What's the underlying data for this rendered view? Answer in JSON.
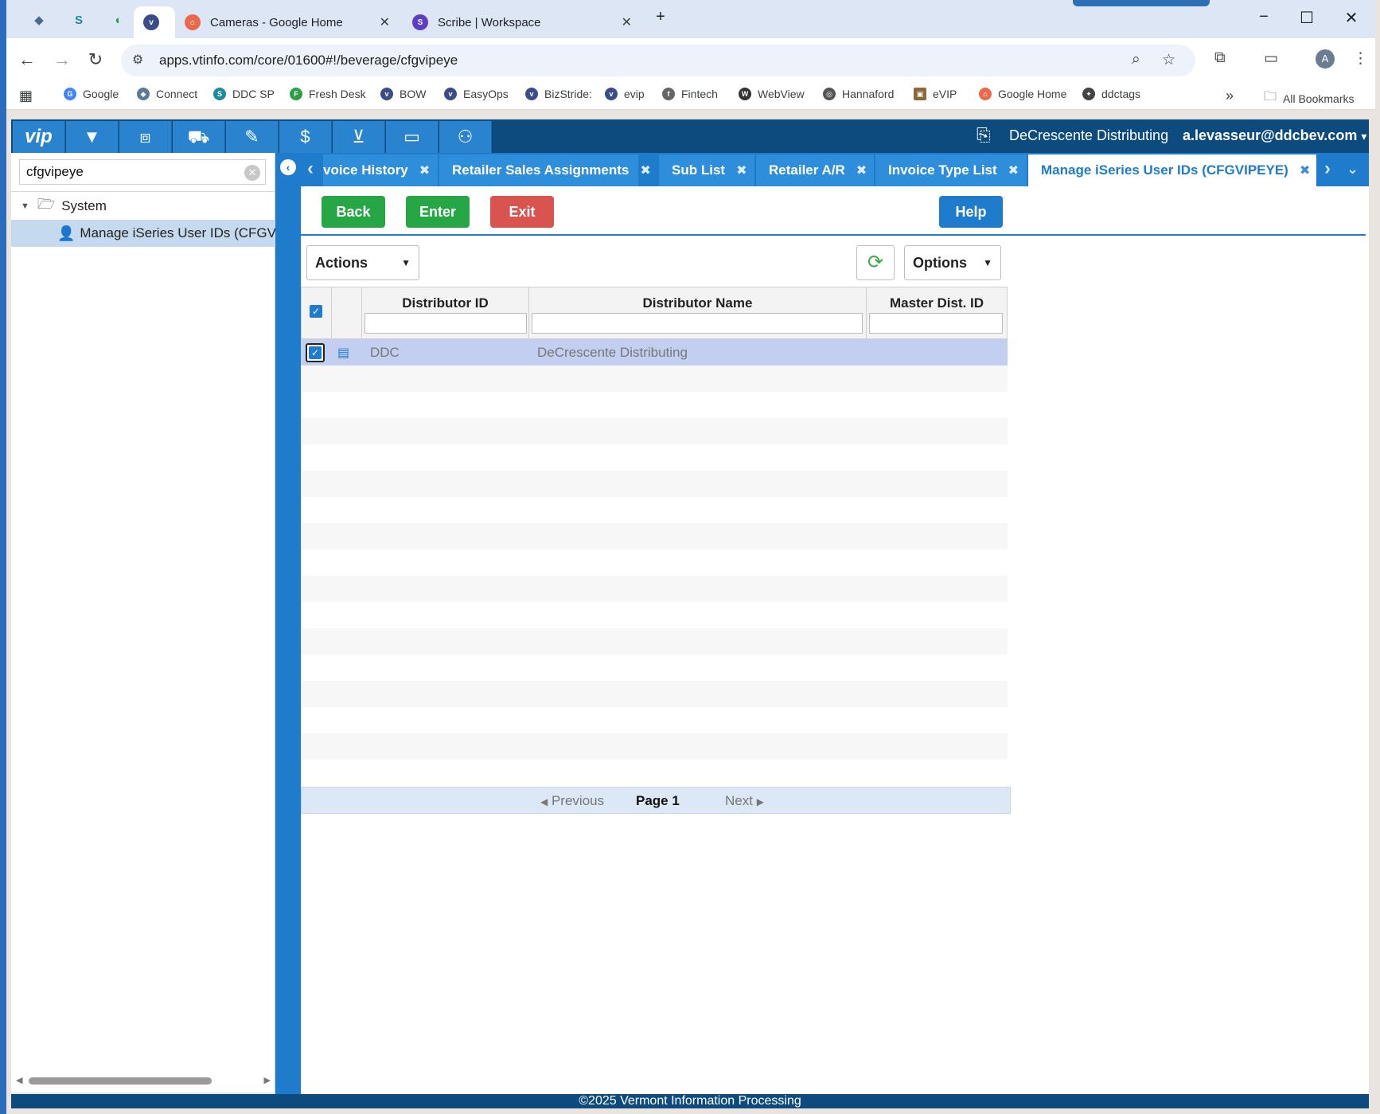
{
  "browser": {
    "tabs": [
      {
        "title": "Cameras - Google Home"
      },
      {
        "title": "Scribe | Workspace"
      }
    ],
    "url": "apps.vtinfo.com/core/01600#!/beverage/cfgvipeye",
    "bookmarks": [
      "Google",
      "Connect",
      "DDC SP",
      "Fresh Desk",
      "BOW",
      "EasyOps",
      "BizStride:",
      "evip",
      "Fintech",
      "WebView",
      "Hannaford",
      "eVIP",
      "Google Home",
      "ddctags"
    ],
    "all_bookmarks": "All Bookmarks",
    "profile_initial": "A"
  },
  "app": {
    "logo": "vip",
    "company": "DeCrescente Distributing",
    "user": "a.levasseur@ddcbev.com",
    "user_caret": "▾"
  },
  "sidebar": {
    "search_value": "cfgvipeye",
    "tree": [
      {
        "label": "System"
      },
      {
        "label": "Manage iSeries User IDs (CFGVIPEYE)"
      }
    ]
  },
  "tabs": [
    {
      "label": "voice History"
    },
    {
      "label": "Retailer Sales Assignments"
    },
    {
      "label": "Sub List"
    },
    {
      "label": "Retailer A/R"
    },
    {
      "label": "Invoice Type List"
    },
    {
      "label": "Manage iSeries User IDs (CFGVIPEYE)"
    }
  ],
  "toolbar": {
    "back": "Back",
    "enter": "Enter",
    "exit": "Exit",
    "help": "Help",
    "actions": "Actions",
    "options": "Options"
  },
  "grid": {
    "columns": [
      "Distributor ID",
      "Distributor Name",
      "Master Dist. ID"
    ],
    "rows": [
      {
        "id": "DDC",
        "name": "DeCrescente Distributing",
        "master": ""
      }
    ]
  },
  "pager": {
    "previous": "Previous",
    "page": "Page 1",
    "next": "Next"
  },
  "footer": "©2025 Vermont Information Processing",
  "colors": {
    "header": "#0d4a7d",
    "accent": "#1f7bcb",
    "green": "#27a646",
    "red": "#d9534f",
    "selected_row": "#c2cff0"
  }
}
